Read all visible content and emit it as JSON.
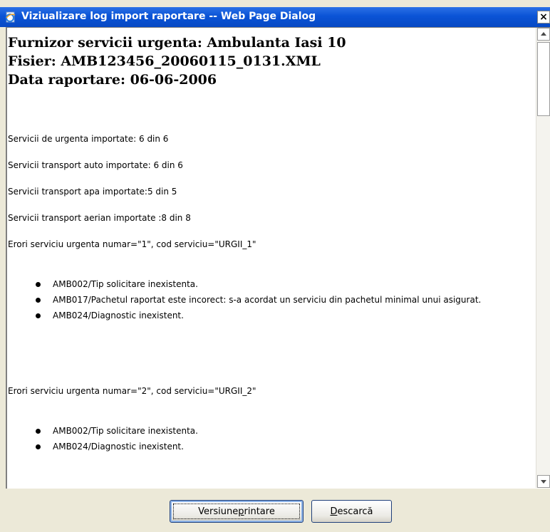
{
  "window": {
    "title": "Viziualizare log import raportare -- Web Page Dialog",
    "close_glyph": "×"
  },
  "report": {
    "provider": "Furnizor servicii urgenta: Ambulanta Iasi 10",
    "file": "Fisier: AMB123456_20060115_0131.XML",
    "date": "Data raportare: 06-06-2006",
    "summary": [
      "Servicii de urgenta importate: 6 din 6",
      "Servicii transport auto importate: 6 din 6",
      "Servicii transport apa importate:5 din 5",
      "Servicii transport aerian importate :8 din 8"
    ],
    "error_groups": [
      {
        "heading": "Erori serviciu urgenta numar=\"1\", cod serviciu=\"URGII_1\"",
        "errors": [
          "AMB002/Tip solicitare inexistenta.",
          "AMB017/Pachetul raportat este incorect: s-a acordat un serviciu din pachetul minimal unui asigurat.",
          "AMB024/Diagnostic inexistent."
        ]
      },
      {
        "heading": "Erori serviciu urgenta numar=\"2\", cod serviciu=\"URGII_2\"",
        "errors": [
          "AMB002/Tip solicitare inexistenta.",
          "AMB024/Diagnostic inexistent."
        ]
      }
    ]
  },
  "buttons": {
    "print_pre": "Versiune ",
    "print_access": "p",
    "print_post": "rintare",
    "download_access": "D",
    "download_post": "escarcă"
  },
  "icons": {
    "title": "ie-page-icon",
    "close": "close-icon",
    "scroll_up": "arrow-up-icon",
    "scroll_down": "arrow-down-icon"
  },
  "colors": {
    "titlebar": "#0a53d6",
    "dialog_bg": "#ece9d8",
    "button_border": "#1f3f7a"
  }
}
